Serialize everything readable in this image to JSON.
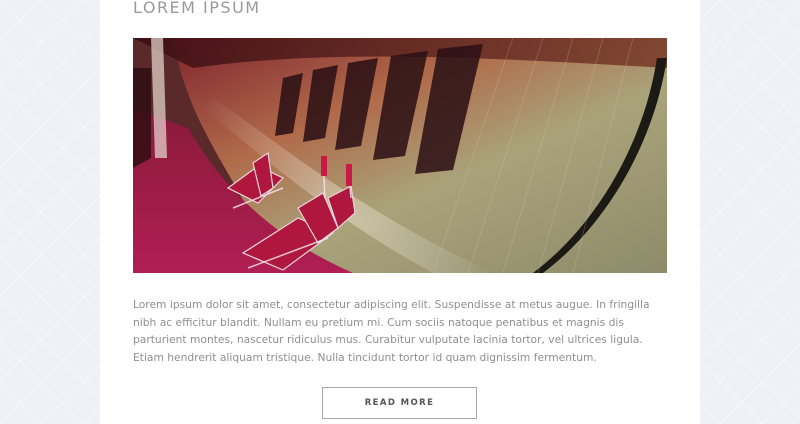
{
  "post": {
    "title": "LOREM IPSUM",
    "body": "Lorem ipsum dolor sit amet, consectetur adipiscing elit. Suspendisse at metus augue. In fringilla nibh ac efficitur blandit. Nullam eu pretium mi. Cum sociis natoque penatibus et magnis dis parturient montes, nascetur ridiculus mus. Curabitur vulputate lacinia tortor, vel ultrices ligula. Etiam hendrerit aliquam tristique. Nulla tincidunt tortor id quam dignissim fermentum.",
    "read_more_label": "READ MORE",
    "image_alt": "curved corridor with red seats"
  },
  "colors": {
    "page_background": "#eef1f5",
    "card_background": "#ffffff",
    "title_text": "#9a9a9a",
    "body_text": "#8f8f8f",
    "button_border": "#a8a8a8",
    "button_text": "#555555"
  }
}
